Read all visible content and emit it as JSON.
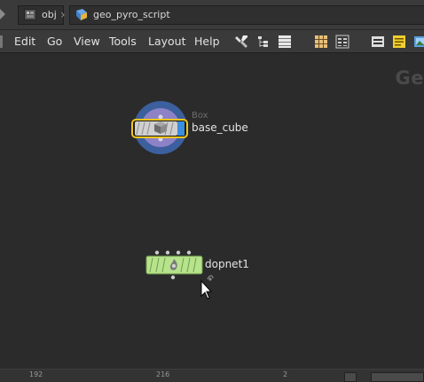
{
  "pathbar": {
    "crumbs": [
      {
        "label": "obj",
        "icon": "folder-icon"
      },
      {
        "label": "geo_pyro_script",
        "icon": "geo-node-icon"
      }
    ]
  },
  "menubar": {
    "items": [
      "Edit",
      "Go",
      "View",
      "Tools",
      "Layout",
      "Help"
    ],
    "tools": [
      "wrench-icon",
      "tree-icon",
      "list-icon",
      "grid-icon",
      "table-icon",
      "parameter-pane-icon",
      "notes-icon",
      "image-icon"
    ]
  },
  "canvas": {
    "context_label": "Ge",
    "nodes": [
      {
        "name": "base_cube",
        "type_label": "Box",
        "flag": "display",
        "icon": "box-icon"
      },
      {
        "name": "dopnet1",
        "type_label": "",
        "icon": "dop-network-icon"
      }
    ]
  },
  "bottombar": {
    "ticks": [
      "192",
      "216",
      "2"
    ]
  },
  "colors": {
    "sop_node": "#d0d0d0",
    "dop_node": "#b6e38c",
    "selection_ring_outer": "#4a72b8",
    "selection_ring_inner": "#8e7ec8",
    "display_outline": "#f0c51a",
    "display_flag": "#3b8fe0"
  }
}
